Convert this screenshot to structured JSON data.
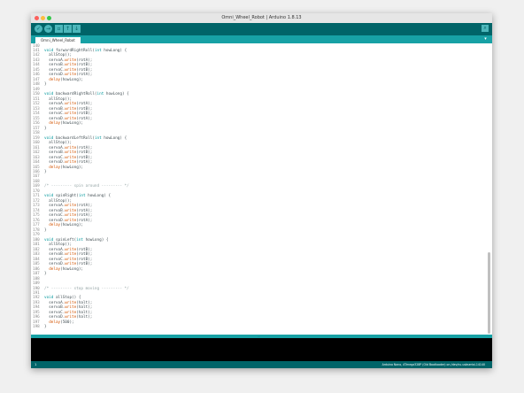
{
  "window": {
    "title": "Omni_Wheel_Robot | Arduino 1.8.13",
    "traffic_colors": [
      "#fc605c",
      "#fdbc40",
      "#34c84a"
    ]
  },
  "toolbar": {
    "buttons": [
      {
        "name": "verify-button",
        "icon": "check-icon",
        "glyph": "✓"
      },
      {
        "name": "upload-button",
        "icon": "arrow-right-icon",
        "glyph": "→"
      },
      {
        "name": "new-button",
        "icon": "new-file-icon",
        "glyph": "▫"
      },
      {
        "name": "open-button",
        "icon": "arrow-up-icon",
        "glyph": "↑"
      },
      {
        "name": "save-button",
        "icon": "arrow-down-icon",
        "glyph": "↓"
      }
    ],
    "serial_monitor_icon": "magnifier-icon",
    "serial_glyph": "⌕",
    "accent": "#006468"
  },
  "tabs": {
    "active": "Omni_Wheel_Robot",
    "menu_glyph": "▾"
  },
  "editor": {
    "lines": [
      {
        "n": "140",
        "t": ""
      },
      {
        "n": "141",
        "t": "void forwardRightRoll(int howLong) {"
      },
      {
        "n": "142",
        "t": "  allStop();"
      },
      {
        "n": "143",
        "t": "  servoA.write(rotA);"
      },
      {
        "n": "144",
        "t": "  servoB.write(rotB);"
      },
      {
        "n": "145",
        "t": "  servoC.write(rotB);"
      },
      {
        "n": "146",
        "t": "  servoD.write(rotA);"
      },
      {
        "n": "147",
        "t": "  delay(howLong);"
      },
      {
        "n": "148",
        "t": "}"
      },
      {
        "n": "149",
        "t": ""
      },
      {
        "n": "150",
        "t": "void backwardRightRoll(int howLong) {"
      },
      {
        "n": "151",
        "t": "  allStop();"
      },
      {
        "n": "152",
        "t": "  servoA.write(rotA);"
      },
      {
        "n": "153",
        "t": "  servoB.write(rotB);"
      },
      {
        "n": "154",
        "t": "  servoC.write(rotB);"
      },
      {
        "n": "155",
        "t": "  servoD.write(rotA);"
      },
      {
        "n": "156",
        "t": "  delay(howLong);"
      },
      {
        "n": "157",
        "t": "}"
      },
      {
        "n": "158",
        "t": ""
      },
      {
        "n": "159",
        "t": "void backwardLeftRoll(int howLong) {"
      },
      {
        "n": "160",
        "t": "  allStop();"
      },
      {
        "n": "161",
        "t": "  servoA.write(rotA);"
      },
      {
        "n": "162",
        "t": "  servoB.write(rotB);"
      },
      {
        "n": "163",
        "t": "  servoC.write(rotB);"
      },
      {
        "n": "164",
        "t": "  servoD.write(rotA);"
      },
      {
        "n": "165",
        "t": "  delay(howLong);"
      },
      {
        "n": "166",
        "t": "}"
      },
      {
        "n": "167",
        "t": ""
      },
      {
        "n": "168",
        "t": ""
      },
      {
        "n": "169",
        "t": "/* --------- spin around --------- */"
      },
      {
        "n": "170",
        "t": ""
      },
      {
        "n": "171",
        "t": "void spinRight(int howLong) {"
      },
      {
        "n": "172",
        "t": "  allStop();"
      },
      {
        "n": "173",
        "t": "  servoA.write(rotA);"
      },
      {
        "n": "174",
        "t": "  servoB.write(rotA);"
      },
      {
        "n": "175",
        "t": "  servoC.write(rotA);"
      },
      {
        "n": "176",
        "t": "  servoD.write(rotA);"
      },
      {
        "n": "177",
        "t": "  delay(howLong);"
      },
      {
        "n": "178",
        "t": "}"
      },
      {
        "n": "179",
        "t": ""
      },
      {
        "n": "180",
        "t": "void spinLeft(int howLong) {"
      },
      {
        "n": "181",
        "t": "  allStop();"
      },
      {
        "n": "182",
        "t": "  servoA.write(rotB);"
      },
      {
        "n": "183",
        "t": "  servoB.write(rotB);"
      },
      {
        "n": "184",
        "t": "  servoC.write(rotB);"
      },
      {
        "n": "185",
        "t": "  servoD.write(rotB);"
      },
      {
        "n": "186",
        "t": "  delay(howLong);"
      },
      {
        "n": "187",
        "t": "}"
      },
      {
        "n": "188",
        "t": ""
      },
      {
        "n": "189",
        "t": ""
      },
      {
        "n": "190",
        "t": "/* --------- stop moving --------- */"
      },
      {
        "n": "191",
        "t": ""
      },
      {
        "n": "192",
        "t": "void allStop() {"
      },
      {
        "n": "193",
        "t": "  servoA.write(halt);"
      },
      {
        "n": "194",
        "t": "  servoB.write(halt);"
      },
      {
        "n": "195",
        "t": "  servoC.write(halt);"
      },
      {
        "n": "196",
        "t": "  servoD.write(halt);"
      },
      {
        "n": "197",
        "t": "  delay(500);"
      },
      {
        "n": "198",
        "t": "}"
      }
    ],
    "keyword_color": "#00979c",
    "function_color": "#d35400",
    "comment_color": "#95a5a6"
  },
  "divider_grip": "⋯",
  "status": {
    "line": "1",
    "board": "Arduino Nano, ATmega328P (Old Bootloader) on /dev/cu.usbserial-14140"
  }
}
